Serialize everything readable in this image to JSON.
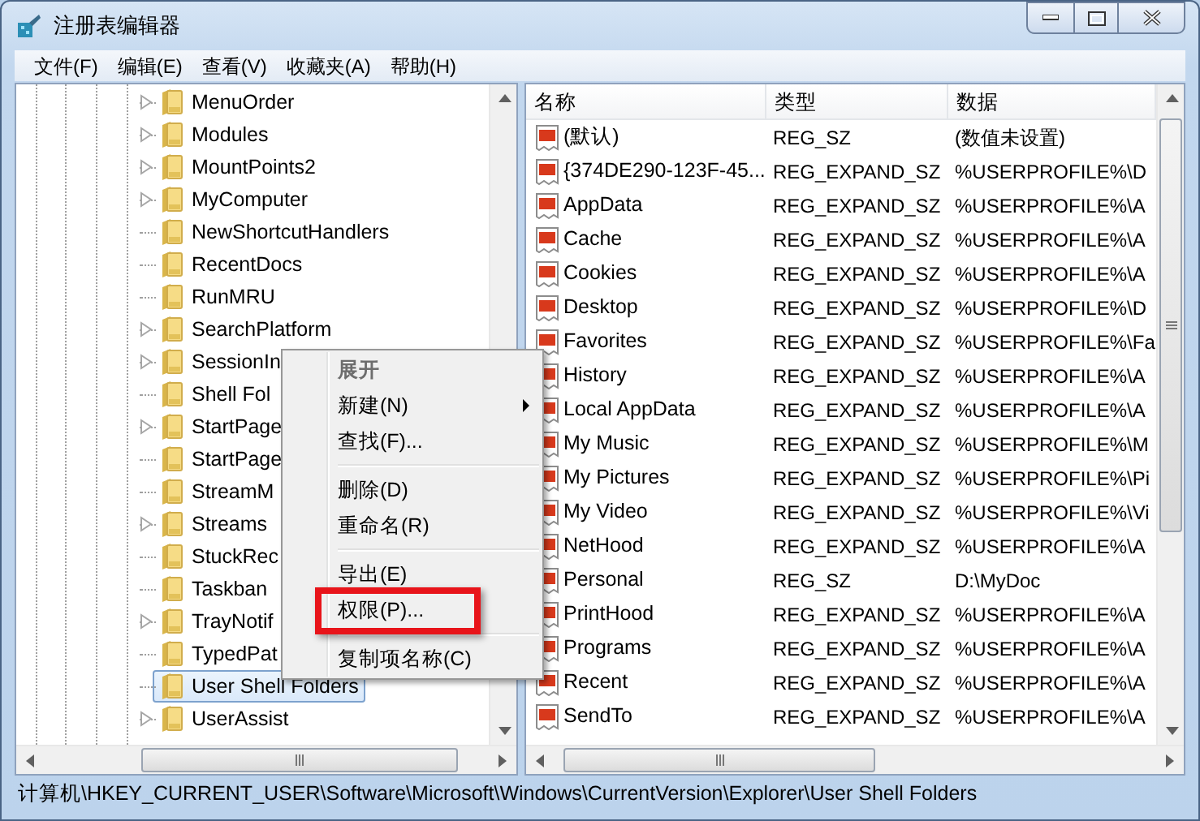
{
  "window": {
    "title": "注册表编辑器"
  },
  "menu_bar": [
    "文件(F)",
    "编辑(E)",
    "查看(V)",
    "收藏夹(A)",
    "帮助(H)"
  ],
  "tree": {
    "items": [
      {
        "label": "MenuOrder",
        "expandable": true,
        "selected": false
      },
      {
        "label": "Modules",
        "expandable": true,
        "selected": false
      },
      {
        "label": "MountPoints2",
        "expandable": true,
        "selected": false
      },
      {
        "label": "MyComputer",
        "expandable": true,
        "selected": false
      },
      {
        "label": "NewShortcutHandlers",
        "expandable": false,
        "selected": false
      },
      {
        "label": "RecentDocs",
        "expandable": false,
        "selected": false
      },
      {
        "label": "RunMRU",
        "expandable": false,
        "selected": false
      },
      {
        "label": "SearchPlatform",
        "expandable": true,
        "selected": false
      },
      {
        "label": "SessionIn",
        "expandable": true,
        "selected": false
      },
      {
        "label": "Shell Fol",
        "expandable": false,
        "selected": false
      },
      {
        "label": "StartPage",
        "expandable": true,
        "selected": false
      },
      {
        "label": "StartPage",
        "expandable": false,
        "selected": false
      },
      {
        "label": "StreamM",
        "expandable": false,
        "selected": false
      },
      {
        "label": "Streams",
        "expandable": true,
        "selected": false
      },
      {
        "label": "StuckRec",
        "expandable": false,
        "selected": false
      },
      {
        "label": "Taskban",
        "expandable": false,
        "selected": false
      },
      {
        "label": "TrayNotif",
        "expandable": true,
        "selected": false
      },
      {
        "label": "TypedPat",
        "expandable": false,
        "selected": false
      },
      {
        "label": "User Shell Folders",
        "expandable": false,
        "selected": true
      },
      {
        "label": "UserAssist",
        "expandable": true,
        "selected": false
      }
    ]
  },
  "values": {
    "columns": [
      "名称",
      "类型",
      "数据"
    ],
    "rows": [
      {
        "name": "(默认)",
        "type": "REG_SZ",
        "data": "(数值未设置)"
      },
      {
        "name": "{374DE290-123F-45...",
        "type": "REG_EXPAND_SZ",
        "data": "%USERPROFILE%\\D"
      },
      {
        "name": "AppData",
        "type": "REG_EXPAND_SZ",
        "data": "%USERPROFILE%\\A"
      },
      {
        "name": "Cache",
        "type": "REG_EXPAND_SZ",
        "data": "%USERPROFILE%\\A"
      },
      {
        "name": "Cookies",
        "type": "REG_EXPAND_SZ",
        "data": "%USERPROFILE%\\A"
      },
      {
        "name": "Desktop",
        "type": "REG_EXPAND_SZ",
        "data": "%USERPROFILE%\\D"
      },
      {
        "name": "Favorites",
        "type": "REG_EXPAND_SZ",
        "data": "%USERPROFILE%\\Fa"
      },
      {
        "name": "History",
        "type": "REG_EXPAND_SZ",
        "data": "%USERPROFILE%\\A"
      },
      {
        "name": "Local AppData",
        "type": "REG_EXPAND_SZ",
        "data": "%USERPROFILE%\\A"
      },
      {
        "name": "My Music",
        "type": "REG_EXPAND_SZ",
        "data": "%USERPROFILE%\\M"
      },
      {
        "name": "My Pictures",
        "type": "REG_EXPAND_SZ",
        "data": "%USERPROFILE%\\Pi"
      },
      {
        "name": "My Video",
        "type": "REG_EXPAND_SZ",
        "data": "%USERPROFILE%\\Vi"
      },
      {
        "name": "NetHood",
        "type": "REG_EXPAND_SZ",
        "data": "%USERPROFILE%\\A"
      },
      {
        "name": "Personal",
        "type": "REG_SZ",
        "data": "D:\\MyDoc"
      },
      {
        "name": "PrintHood",
        "type": "REG_EXPAND_SZ",
        "data": "%USERPROFILE%\\A"
      },
      {
        "name": "Programs",
        "type": "REG_EXPAND_SZ",
        "data": "%USERPROFILE%\\A"
      },
      {
        "name": "Recent",
        "type": "REG_EXPAND_SZ",
        "data": "%USERPROFILE%\\A"
      },
      {
        "name": "SendTo",
        "type": "REG_EXPAND_SZ",
        "data": "%USERPROFILE%\\A"
      }
    ]
  },
  "context_menu": {
    "items": [
      {
        "kind": "item",
        "label": "展开",
        "disabled": true,
        "submenu": false,
        "highlighted": false
      },
      {
        "kind": "item",
        "label": "新建(N)",
        "disabled": false,
        "submenu": true,
        "highlighted": false
      },
      {
        "kind": "item",
        "label": "查找(F)...",
        "disabled": false,
        "submenu": false,
        "highlighted": false
      },
      {
        "kind": "separator"
      },
      {
        "kind": "item",
        "label": "删除(D)",
        "disabled": false,
        "submenu": false,
        "highlighted": false
      },
      {
        "kind": "item",
        "label": "重命名(R)",
        "disabled": false,
        "submenu": false,
        "highlighted": false
      },
      {
        "kind": "separator"
      },
      {
        "kind": "item",
        "label": "导出(E)",
        "disabled": false,
        "submenu": false,
        "highlighted": false
      },
      {
        "kind": "item",
        "label": "权限(P)...",
        "disabled": false,
        "submenu": false,
        "highlighted": true
      },
      {
        "kind": "separator"
      },
      {
        "kind": "item",
        "label": "复制项名称(C)",
        "disabled": false,
        "submenu": false,
        "highlighted": false
      }
    ]
  },
  "status_bar": "计算机\\HKEY_CURRENT_USER\\Software\\Microsoft\\Windows\\CurrentVersion\\Explorer\\User Shell Folders"
}
